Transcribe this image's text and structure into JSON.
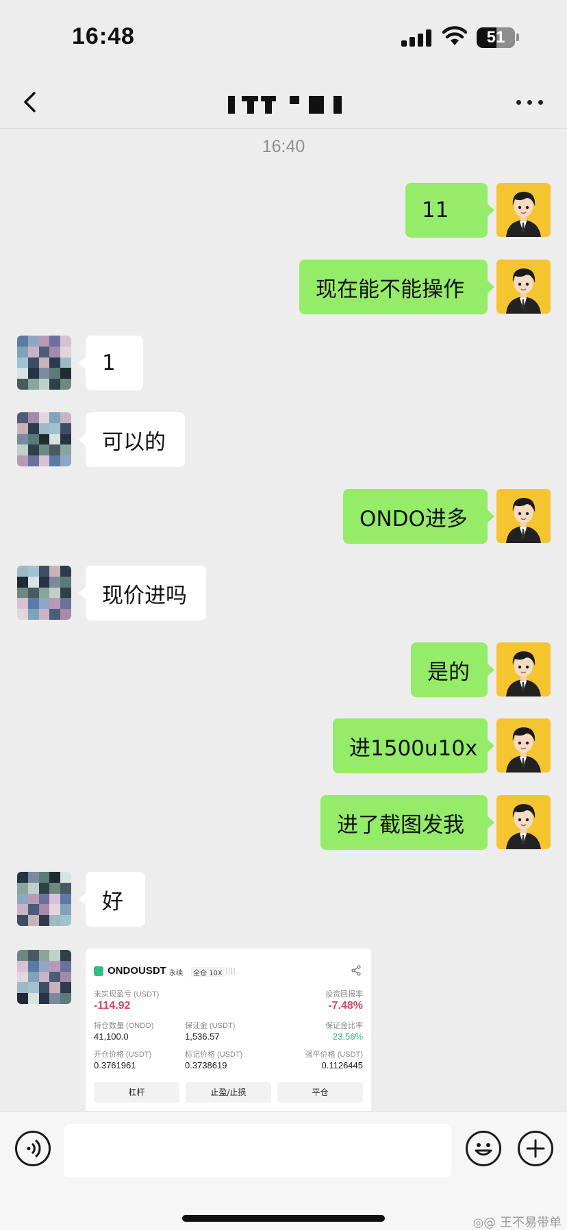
{
  "status_bar": {
    "time": "16:48",
    "battery": "51",
    "battery_level": 0.51
  },
  "header": {
    "back_icon": "chevron-left-icon",
    "more_icon": "more-dots-icon"
  },
  "time_divider": "16:40",
  "messages": [
    {
      "side": "self",
      "text": "11"
    },
    {
      "side": "self",
      "text": "现在能不能操作"
    },
    {
      "side": "other",
      "text": "1"
    },
    {
      "side": "other",
      "text": "可以的"
    },
    {
      "side": "self",
      "text": "ONDO进多"
    },
    {
      "side": "other",
      "text": "现价进吗"
    },
    {
      "side": "self",
      "text": "是的"
    },
    {
      "side": "self",
      "text": "进1500u10x"
    },
    {
      "side": "self",
      "text": "进了截图发我"
    },
    {
      "side": "other",
      "text": "好"
    }
  ],
  "screenshot": {
    "symbol": "ONDOUSDT",
    "tag_perpetual": "永续",
    "tag_margin": "全仓 10X",
    "unrealized_pnl_label": "未实现盈亏 (USDT)",
    "unrealized_pnl": "-114.92",
    "roi_label": "投资回报率",
    "roi": "-7.48%",
    "position_qty_label": "持仓数量 (ONDO)",
    "position_qty": "41,100.0",
    "margin_label": "保证金 (USDT)",
    "margin": "1,536.57",
    "margin_ratio_label": "保证金比率",
    "margin_ratio": "23.56%",
    "entry_price_label": "开仓价格 (USDT)",
    "entry_price": "0.3761961",
    "mark_price_label": "标记价格 (USDT)",
    "mark_price": "0.3738619",
    "liq_price_label": "强平价格 (USDT)",
    "liq_price": "0.1126445",
    "btn_leverage": "杠杆",
    "btn_tpsl": "止盈/止损",
    "btn_close": "平仓",
    "colors": {
      "negative": "#d9475a",
      "positive": "#2ebd85"
    }
  },
  "input_bar": {
    "placeholder": ""
  },
  "watermark": "◎@ 王不易带单",
  "colors": {
    "self_bubble": "#95ec69",
    "other_bubble": "#ffffff",
    "background": "#ededed"
  }
}
